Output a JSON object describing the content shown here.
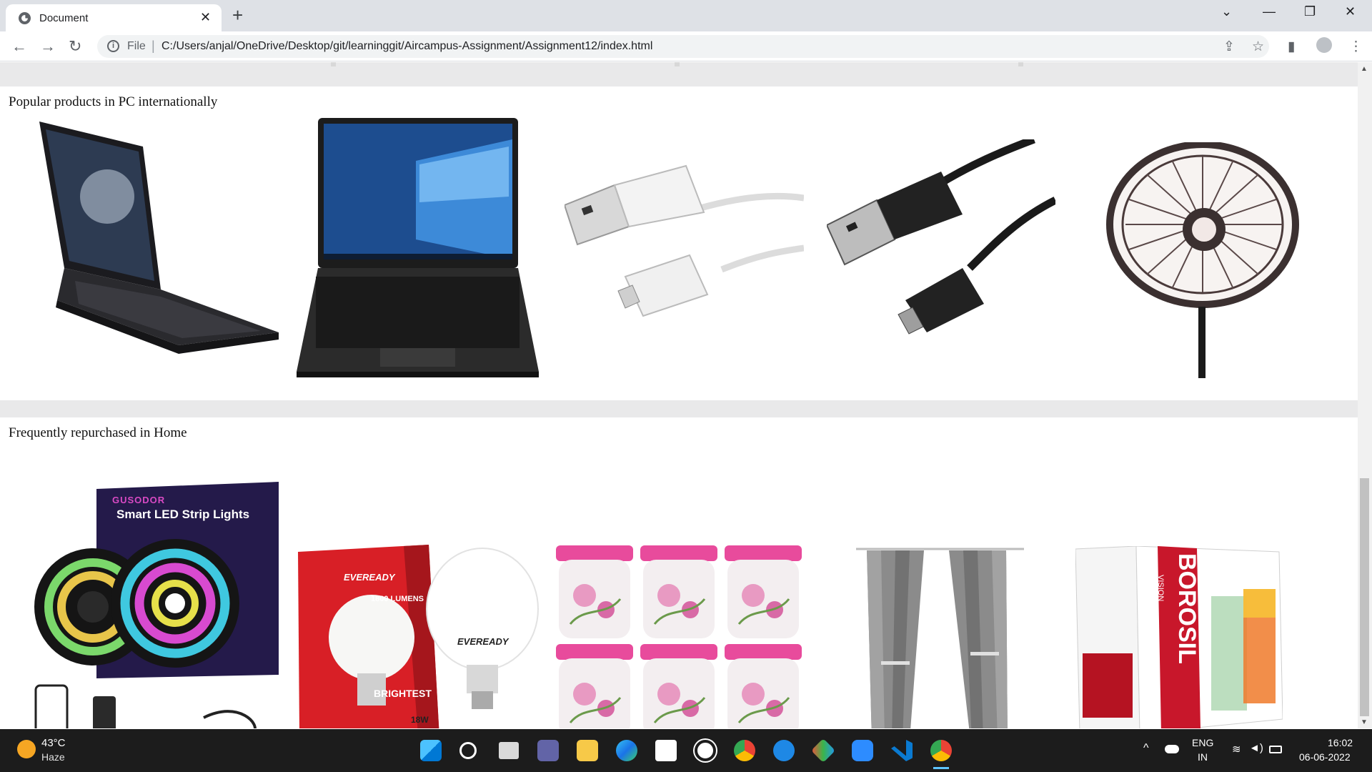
{
  "browser": {
    "tab_title": "Document",
    "file_label": "File",
    "url": "C:/Users/anjal/OneDrive/Desktop/git/learninggit/Aircampus-Assignment/Assignment12/index.html"
  },
  "sections": [
    {
      "heading": "Popular products in PC internationally",
      "products": [
        {
          "icon": "gaming-laptop-angled"
        },
        {
          "icon": "gaming-laptop-front"
        },
        {
          "icon": "usb-cable-white"
        },
        {
          "icon": "usb-cable-black"
        },
        {
          "icon": "desk-fan"
        }
      ]
    },
    {
      "heading": "Frequently repurchased in Home",
      "products": [
        {
          "icon": "led-strip-lights",
          "brand": "GUSODOR",
          "label": "Smart LED Strip Lights"
        },
        {
          "icon": "led-bulb",
          "brand": "EVEREADY",
          "label": "1800 LUMENS",
          "sub": "BRIGHTEST",
          "watt": "18W"
        },
        {
          "icon": "storage-jars"
        },
        {
          "icon": "curtains"
        },
        {
          "icon": "glass-set",
          "brand": "BOROSIL",
          "sub": "VISION"
        }
      ]
    }
  ],
  "taskbar": {
    "temperature": "43°C",
    "weather": "Haze",
    "lang_1": "ENG",
    "lang_2": "IN",
    "time": "16:02",
    "date": "06-06-2022"
  }
}
